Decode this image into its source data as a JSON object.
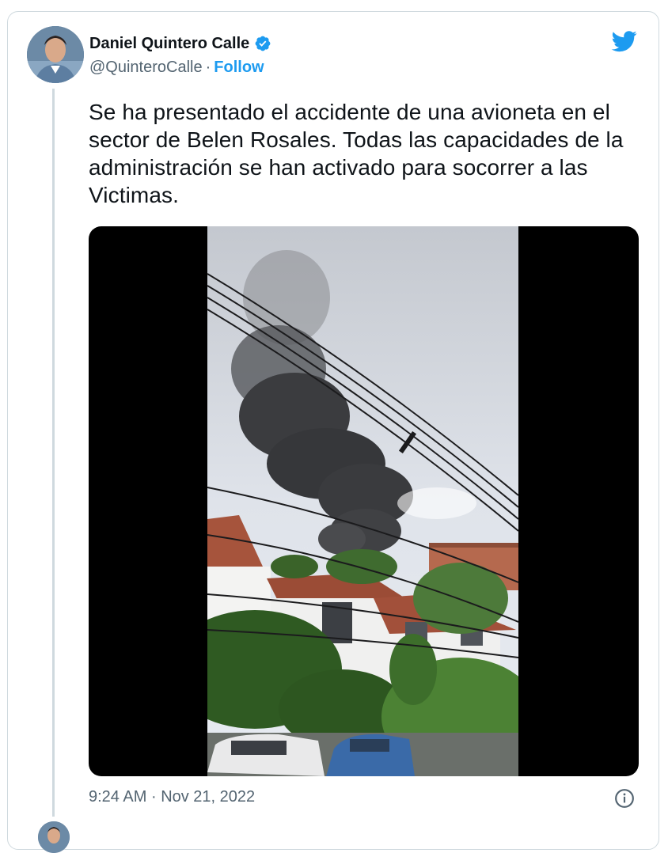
{
  "tweet": {
    "author_name": "Daniel Quintero Calle",
    "handle": "@QuinteroCalle",
    "separator": "·",
    "follow_label": "Follow",
    "text": "Se ha presentado el accidente de una avioneta en el sector de Belen Rosales. Todas las capacidades de la administración se han activado para socorrer a las Victimas.",
    "time": "9:24 AM",
    "date": "Nov 21, 2022",
    "meta_separator": "·"
  },
  "colors": {
    "accent": "#1d9bf0",
    "text_primary": "#0f1419",
    "text_secondary": "#536471",
    "border": "#cfd9de"
  },
  "icons": {
    "verified": "verified-badge-icon",
    "brand": "twitter-bird-icon",
    "info": "info-icon"
  }
}
